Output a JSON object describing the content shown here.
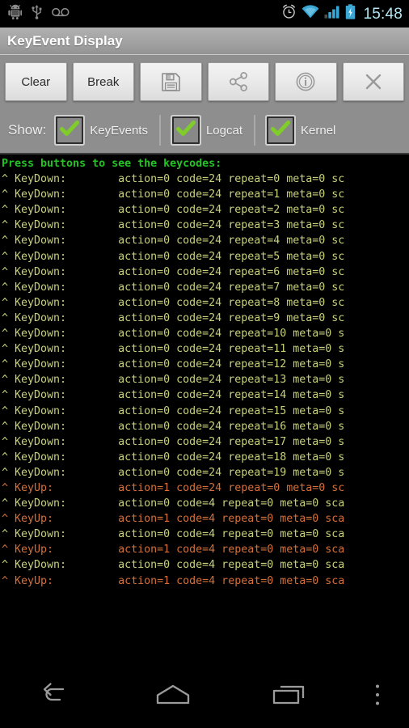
{
  "status_bar": {
    "left_icons": [
      {
        "name": "android-debug-icon",
        "label": "android"
      },
      {
        "name": "usb-icon",
        "label": "usb"
      },
      {
        "name": "voicemail-icon",
        "label": "voicemail"
      }
    ],
    "right_icons": [
      {
        "name": "alarm-clock-icon",
        "label": "alarm"
      },
      {
        "name": "wifi-icon",
        "label": "wifi"
      },
      {
        "name": "signal-bars-icon",
        "label": "signal"
      },
      {
        "name": "battery-charging-icon",
        "label": "battery charging"
      }
    ],
    "clock": "15:48"
  },
  "title_bar": {
    "title": "KeyEvent Display"
  },
  "toolbar": {
    "buttons": [
      {
        "name": "clear-button",
        "label": "Clear",
        "icon": null
      },
      {
        "name": "break-button",
        "label": "Break",
        "icon": null
      },
      {
        "name": "save-button",
        "label": "",
        "icon": "floppy-disk-icon"
      },
      {
        "name": "share-button",
        "label": "",
        "icon": "share-icon"
      },
      {
        "name": "info-button",
        "label": "",
        "icon": "info-circle-icon"
      },
      {
        "name": "close-button",
        "label": "",
        "icon": "close-x-icon"
      }
    ]
  },
  "show_row": {
    "label": "Show:",
    "checkboxes": [
      {
        "name": "checkbox-keyevents",
        "label": "KeyEvents",
        "checked": true
      },
      {
        "name": "checkbox-logcat",
        "label": "Logcat",
        "checked": true
      },
      {
        "name": "checkbox-kernel",
        "label": "Kernel",
        "checked": true
      }
    ],
    "check_color": "#7fcc2b"
  },
  "log": {
    "header": "Press buttons to see the keycodes:",
    "lines": [
      {
        "type": "keydown",
        "text": "^ KeyDown:        action=0 code=24 repeat=0 meta=0 sc"
      },
      {
        "type": "keydown",
        "text": "^ KeyDown:        action=0 code=24 repeat=1 meta=0 sc"
      },
      {
        "type": "keydown",
        "text": "^ KeyDown:        action=0 code=24 repeat=2 meta=0 sc"
      },
      {
        "type": "keydown",
        "text": "^ KeyDown:        action=0 code=24 repeat=3 meta=0 sc"
      },
      {
        "type": "keydown",
        "text": "^ KeyDown:        action=0 code=24 repeat=4 meta=0 sc"
      },
      {
        "type": "keydown",
        "text": "^ KeyDown:        action=0 code=24 repeat=5 meta=0 sc"
      },
      {
        "type": "keydown",
        "text": "^ KeyDown:        action=0 code=24 repeat=6 meta=0 sc"
      },
      {
        "type": "keydown",
        "text": "^ KeyDown:        action=0 code=24 repeat=7 meta=0 sc"
      },
      {
        "type": "keydown",
        "text": "^ KeyDown:        action=0 code=24 repeat=8 meta=0 sc"
      },
      {
        "type": "keydown",
        "text": "^ KeyDown:        action=0 code=24 repeat=9 meta=0 sc"
      },
      {
        "type": "keydown",
        "text": "^ KeyDown:        action=0 code=24 repeat=10 meta=0 s"
      },
      {
        "type": "keydown",
        "text": "^ KeyDown:        action=0 code=24 repeat=11 meta=0 s"
      },
      {
        "type": "keydown",
        "text": "^ KeyDown:        action=0 code=24 repeat=12 meta=0 s"
      },
      {
        "type": "keydown",
        "text": "^ KeyDown:        action=0 code=24 repeat=13 meta=0 s"
      },
      {
        "type": "keydown",
        "text": "^ KeyDown:        action=0 code=24 repeat=14 meta=0 s"
      },
      {
        "type": "keydown",
        "text": "^ KeyDown:        action=0 code=24 repeat=15 meta=0 s"
      },
      {
        "type": "keydown",
        "text": "^ KeyDown:        action=0 code=24 repeat=16 meta=0 s"
      },
      {
        "type": "keydown",
        "text": "^ KeyDown:        action=0 code=24 repeat=17 meta=0 s"
      },
      {
        "type": "keydown",
        "text": "^ KeyDown:        action=0 code=24 repeat=18 meta=0 s"
      },
      {
        "type": "keydown",
        "text": "^ KeyDown:        action=0 code=24 repeat=19 meta=0 s"
      },
      {
        "type": "keyup",
        "text": "^ KeyUp:          action=1 code=24 repeat=0 meta=0 sc"
      },
      {
        "type": "keydown",
        "text": "^ KeyDown:        action=0 code=4 repeat=0 meta=0 sca"
      },
      {
        "type": "keyup",
        "text": "^ KeyUp:          action=1 code=4 repeat=0 meta=0 sca"
      },
      {
        "type": "keydown",
        "text": "^ KeyDown:        action=0 code=4 repeat=0 meta=0 sca"
      },
      {
        "type": "keyup",
        "text": "^ KeyUp:          action=1 code=4 repeat=0 meta=0 sca"
      },
      {
        "type": "keydown",
        "text": "^ KeyDown:        action=0 code=4 repeat=0 meta=0 sca"
      },
      {
        "type": "keyup",
        "text": "^ KeyUp:          action=1 code=4 repeat=0 meta=0 sca"
      }
    ],
    "colors": {
      "background": "#000000",
      "header": "#22c322",
      "keydown": "#c8d17a",
      "keyup": "#d4703a"
    }
  },
  "nav_bar": {
    "buttons": [
      {
        "name": "nav-back-button",
        "label": "back"
      },
      {
        "name": "nav-home-button",
        "label": "home"
      },
      {
        "name": "nav-recents-button",
        "label": "recent apps"
      },
      {
        "name": "nav-menu-button",
        "label": "menu"
      }
    ]
  }
}
